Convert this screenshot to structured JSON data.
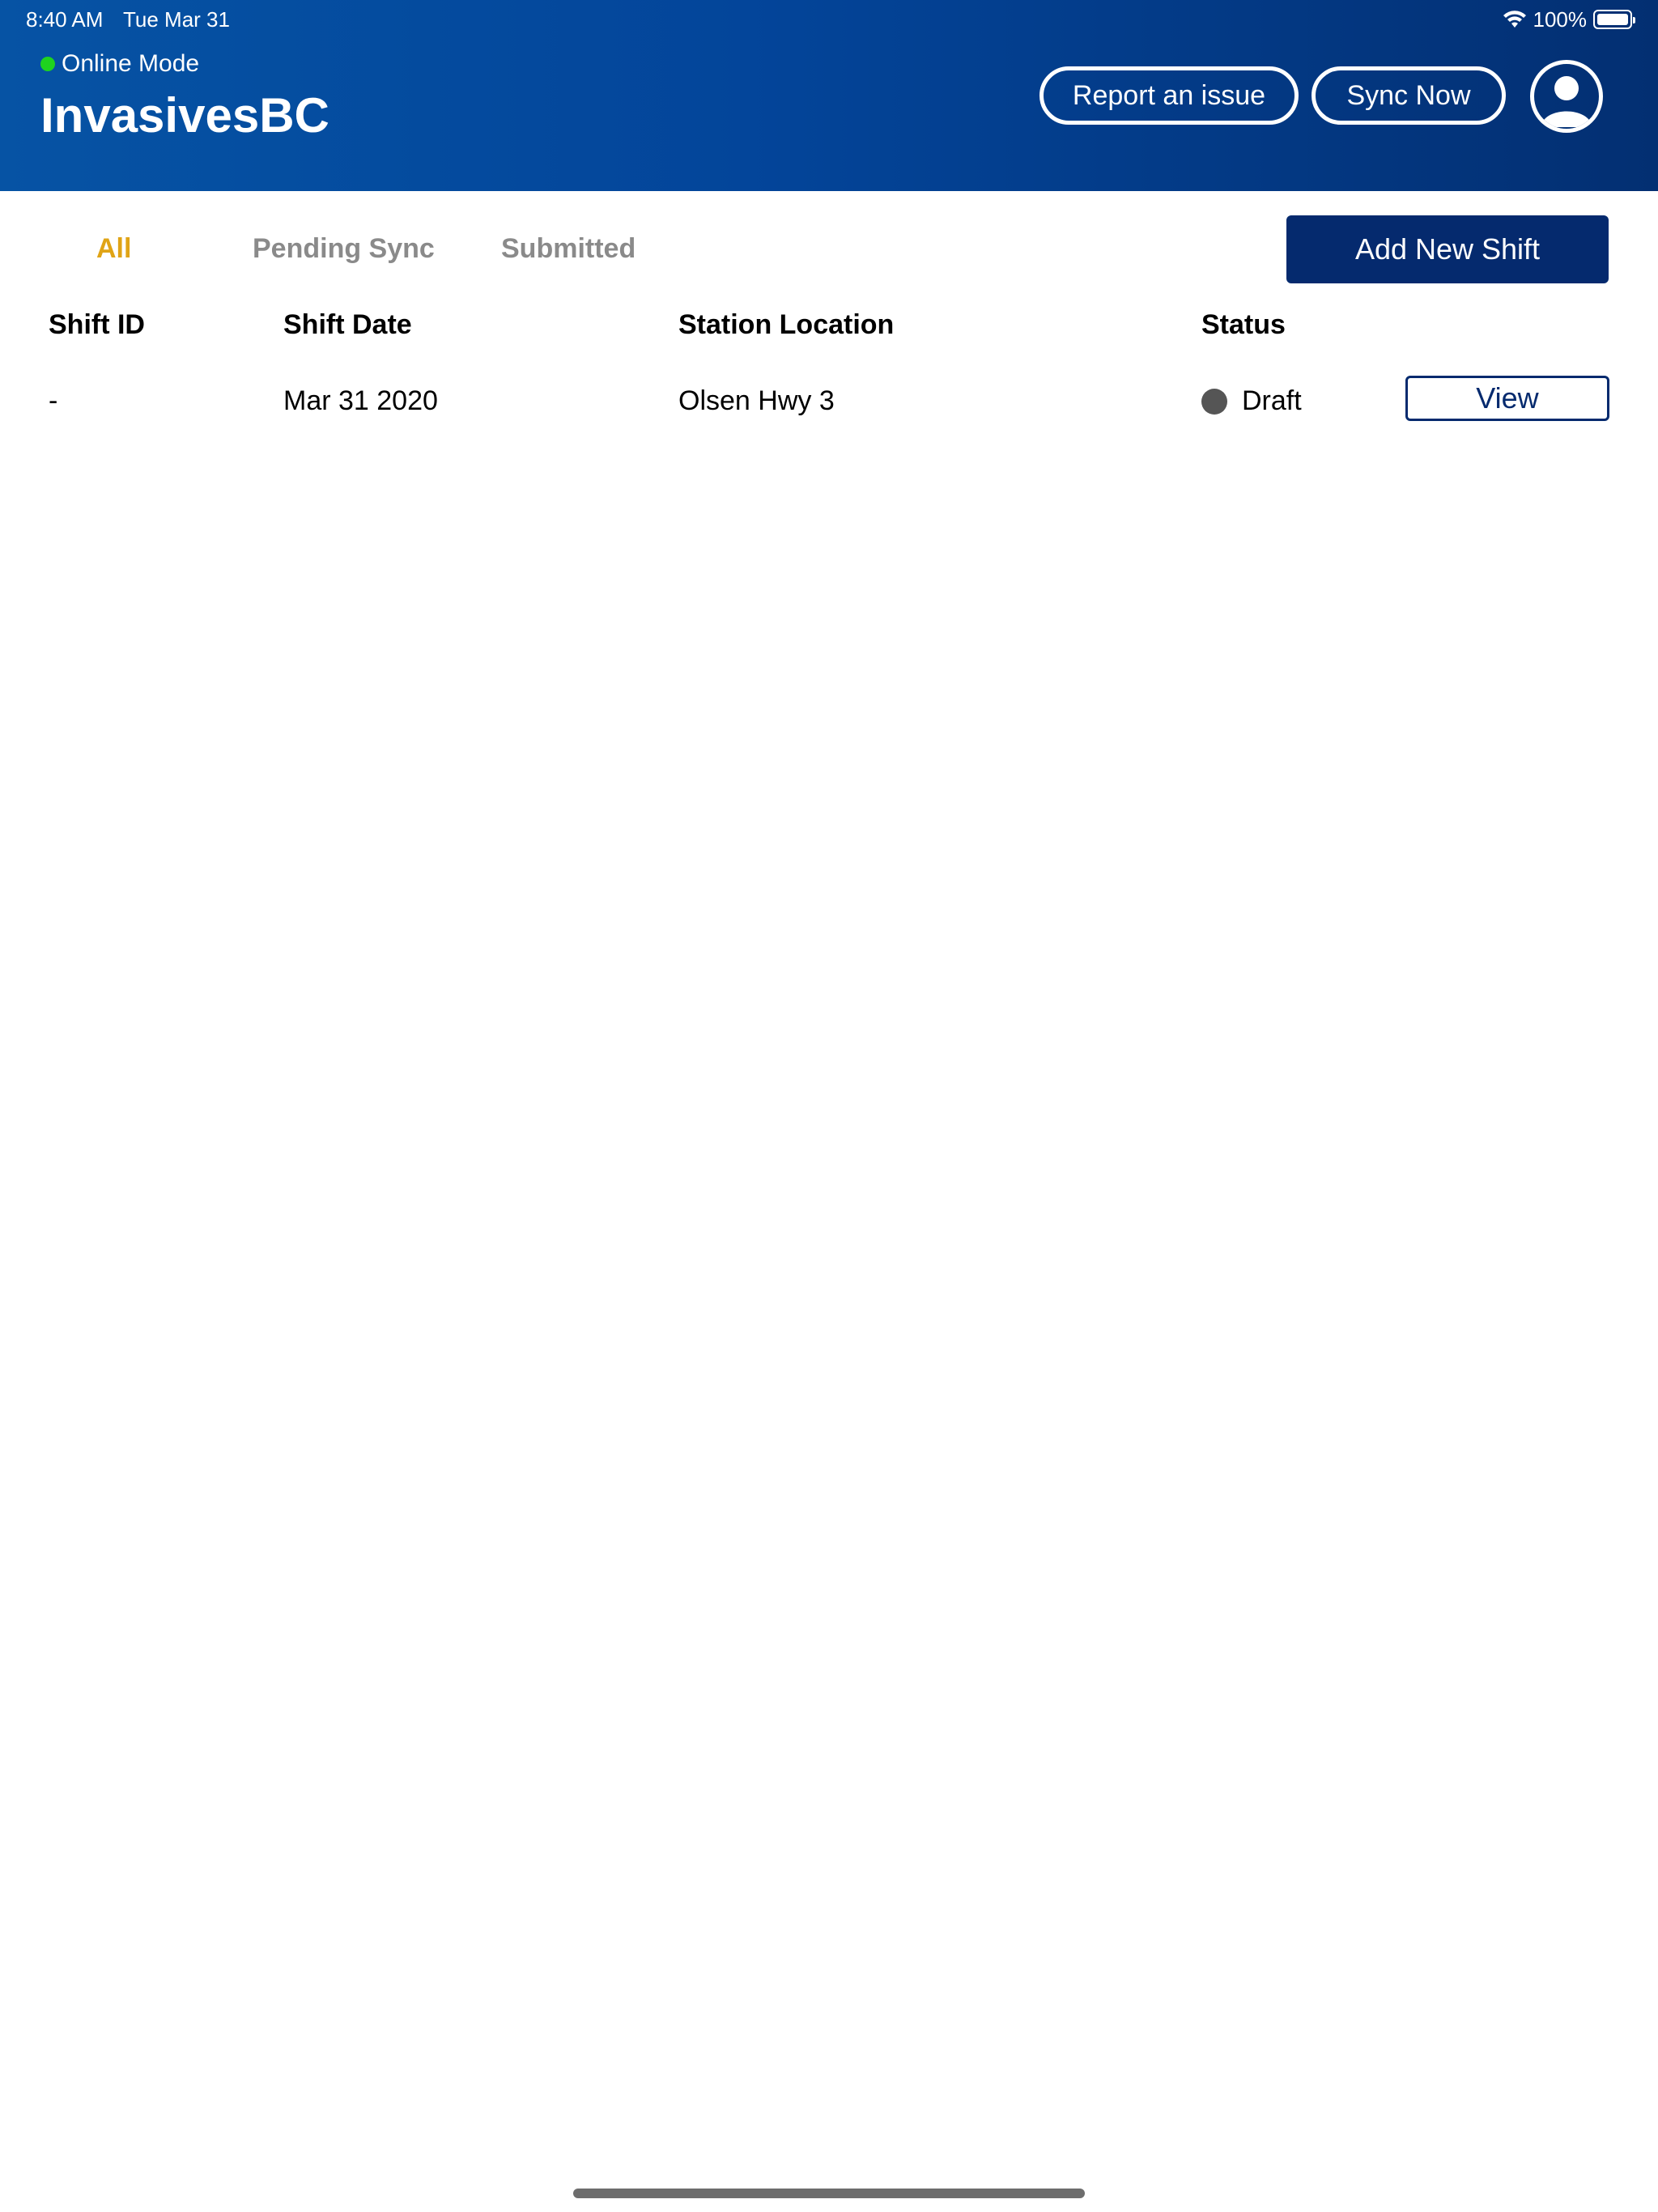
{
  "status_bar": {
    "time": "8:40 AM",
    "date": "Tue Mar 31",
    "battery": "100%",
    "wifi_icon": "wifi-icon",
    "battery_icon": "battery-full-icon"
  },
  "header": {
    "mode_label": "Online Mode",
    "mode_color": "#1fd31f",
    "title": "InvasivesBC",
    "report_button": "Report an issue",
    "sync_button": "Sync Now",
    "profile_icon": "user-avatar-icon"
  },
  "tabs": [
    {
      "label": "All",
      "active": true
    },
    {
      "label": "Pending Sync",
      "active": false
    },
    {
      "label": "Submitted",
      "active": false
    }
  ],
  "add_button": "Add New Shift",
  "table": {
    "columns": [
      "Shift ID",
      "Shift Date",
      "Station Location",
      "Status"
    ],
    "rows": [
      {
        "shift_id": "-",
        "shift_date": "Mar 31 2020",
        "station_location": "Olsen Hwy 3",
        "status": "Draft",
        "action": "View"
      }
    ]
  },
  "colors": {
    "header_start": "#0653a4",
    "header_end": "#032f72",
    "accent_active_tab": "#e0a416",
    "primary_button": "#052a6e",
    "draft_status": "#555555"
  }
}
